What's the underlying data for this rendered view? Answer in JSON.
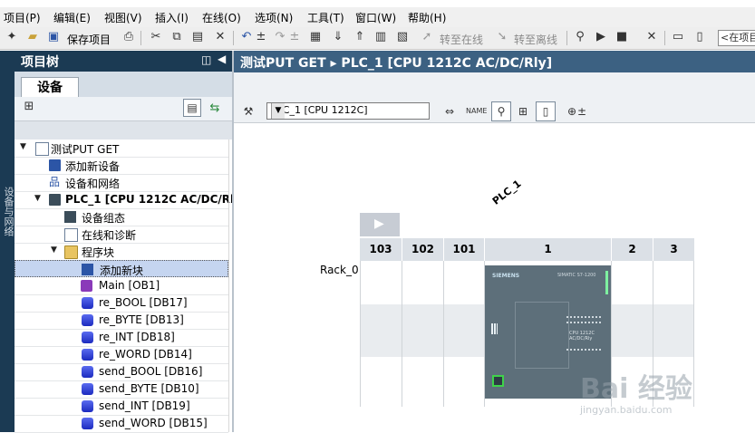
{
  "menu": [
    "项目(P)",
    "编辑(E)",
    "视图(V)",
    "插入(I)",
    "在线(O)",
    "选项(N)",
    "工具(T)",
    "窗口(W)",
    "帮助(H)"
  ],
  "toolbar": {
    "save_project": "保存项目",
    "go_online": "转至在线",
    "go_offline": "转至离线",
    "search_placeholder": "<在项目"
  },
  "left_strip": {
    "label": "设备与网络"
  },
  "project_tree": {
    "title": "项目树",
    "tab": "设备",
    "items": [
      {
        "label": "测试PUT GET",
        "icon": "project-icon",
        "expanded": true
      },
      {
        "label": "添加新设备",
        "icon": "add-device-icon"
      },
      {
        "label": "设备和网络",
        "icon": "network-icon"
      },
      {
        "label": "PLC_1 [CPU 1212C AC/DC/Rly]",
        "icon": "plc-icon",
        "expanded": true
      },
      {
        "label": "设备组态",
        "icon": "device-config-icon"
      },
      {
        "label": "在线和诊断",
        "icon": "online-diagnostics-icon"
      },
      {
        "label": "程序块",
        "icon": "folder-icon",
        "expanded": true
      },
      {
        "label": "添加新块",
        "icon": "add-block-icon",
        "selected": true
      },
      {
        "label": "Main [OB1]",
        "icon": "ob-icon"
      },
      {
        "label": "re_BOOL [DB17]",
        "icon": "db-icon"
      },
      {
        "label": "re_BYTE [DB13]",
        "icon": "db-icon"
      },
      {
        "label": "re_INT [DB18]",
        "icon": "db-icon"
      },
      {
        "label": "re_WORD [DB14]",
        "icon": "db-icon"
      },
      {
        "label": "send_BOOL [DB16]",
        "icon": "db-icon"
      },
      {
        "label": "send_BYTE [DB10]",
        "icon": "db-icon"
      },
      {
        "label": "send_INT [DB19]",
        "icon": "db-icon"
      },
      {
        "label": "send_WORD [DB15]",
        "icon": "db-icon"
      }
    ]
  },
  "editor": {
    "breadcrumb": "测试PUT GET  ▸  PLC_1 [CPU 1212C AC/DC/Rly]",
    "device_select": "PLC_1 [CPU 1212C]",
    "device_name": "PLC_1",
    "rack_label": "Rack_0",
    "slots": [
      "103",
      "102",
      "101",
      "1",
      "2",
      "3"
    ],
    "cpu": {
      "brand": "SIEMENS",
      "model": "SIMATIC S7-1200",
      "spec_line1": "CPU 1212C",
      "spec_line2": "AC/DC/Rly"
    }
  },
  "watermark": {
    "main": "Bai 经验",
    "sub": "jingyan.baidu.com"
  },
  "colors": {
    "panel_header": "#1b3a53",
    "editor_header": "#3c6182",
    "selection": "#c5d5f0",
    "db_icon": "#2b3bd8",
    "ob_icon": "#8a3ab9"
  }
}
